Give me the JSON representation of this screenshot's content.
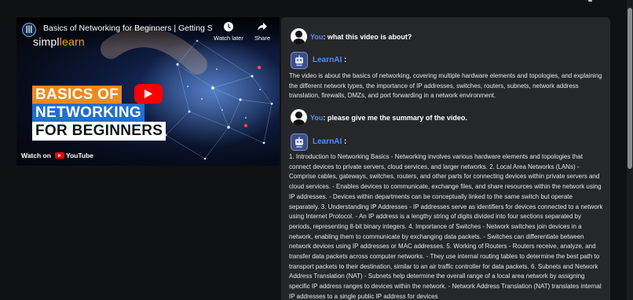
{
  "video": {
    "title": "Basics of Networking for Beginners | Getting Star...",
    "channel_logo_text": "|||",
    "brand_prefix": "simpl",
    "brand_suffix": "learn",
    "watch_later_label": "Watch later",
    "share_label": "Share",
    "thumbnail_lines": [
      "BASICS OF",
      "NETWORKING",
      "FOR BEGINNERS"
    ],
    "watch_on_label": "Watch on",
    "youtube_label": "YouTube",
    "icons": [
      "clock-icon",
      "share-arrow-icon",
      "youtube-play-icon"
    ]
  },
  "chat": {
    "messages": [
      {
        "role": "user",
        "speaker": "You",
        "text": ": what this video is about?"
      },
      {
        "role": "bot",
        "speaker": "LearnAI",
        "colon": " :",
        "text": "The video is about the basics of networking, covering multiple hardware elements and topologies, and explaining the different network types, the importance of IP addresses, switches, routers, subnets, network address translation, firewalls, DMZs, and port forwarding in a network environment."
      },
      {
        "role": "user",
        "speaker": "You",
        "text": ": please give me the summary of the video."
      },
      {
        "role": "bot",
        "speaker": "LearnAI",
        "colon": " :",
        "text": "1. Introduction to Networking Basics - Networking involves various hardware elements and topologies that connect devices to private servers, cloud services, and larger networks. 2. Local Area Networks (LANs) - Comprise cables, gateways, switches, routers, and other parts for connecting devices within private servers and cloud services. - Enables devices to communicate, exchange files, and share resources within the network using IP addresses. - Devices within departments can be conceptually linked to the same switch but operate separately. 3. Understanding IP Addresses - IP addresses serve as identifiers for devices connected to a network using Internet Protocol. - An IP address is a lengthy string of digits divided into four sections separated by periods, representing 8-bit binary integers. 4. Importance of Switches - Network switches join devices in a network, enabling them to communicate by exchanging data packets. - Switches can differentiate between network devices using IP addresses or MAC addresses. 5. Working of Routers - Routers receive, analyze, and transfer data packets across computer networks. - They use internal routing tables to determine the best path to transport packets to their destination, similar to an air traffic controller for data packets. 6. Subnets and Network Address Translation (NAT) - Subnets help determine the overall range of a local area network by assigning specific IP address ranges to devices within the network. - Network Address Translation (NAT) translates internal IP addresses to a single public IP address for devices"
      }
    ]
  },
  "colors": {
    "background": "#101114",
    "panel": "#26272b",
    "accent_blue": "#4f8ff7",
    "thumb_orange": "#f08a1c",
    "thumb_blue": "#1f6fd1",
    "youtube_red": "#ff0000"
  }
}
